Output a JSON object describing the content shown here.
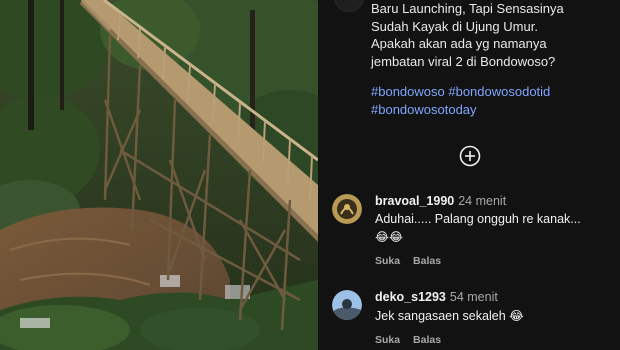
{
  "post": {
    "caption_lines": [
      "Baru Launching, Tapi Sensasinya",
      "Sudah Kayak di Ujung Umur.",
      "Apakah akan ada yg namanya",
      "jembatan viral 2 di Bondowoso?"
    ],
    "hashtags": [
      "#bondowoso",
      "#bondowosodotid",
      "#bondowosotoday"
    ]
  },
  "comments": [
    {
      "username": "bravoal_1990",
      "time": "24 menit",
      "text": "Aduhai..... Palang ongguh re kanak...",
      "emoji": "😂😂",
      "like_label": "Suka",
      "reply_label": "Balas"
    },
    {
      "username": "deko_s1293",
      "time": "54 menit",
      "text": "Jek sangasaen sekaleh 😂",
      "like_label": "Suka",
      "reply_label": "Balas"
    }
  ],
  "icons": {
    "add": "plus-circle-icon"
  },
  "colors": {
    "background": "#121212",
    "hashtag": "#7ea6ff",
    "muted": "#a8a8a8"
  }
}
